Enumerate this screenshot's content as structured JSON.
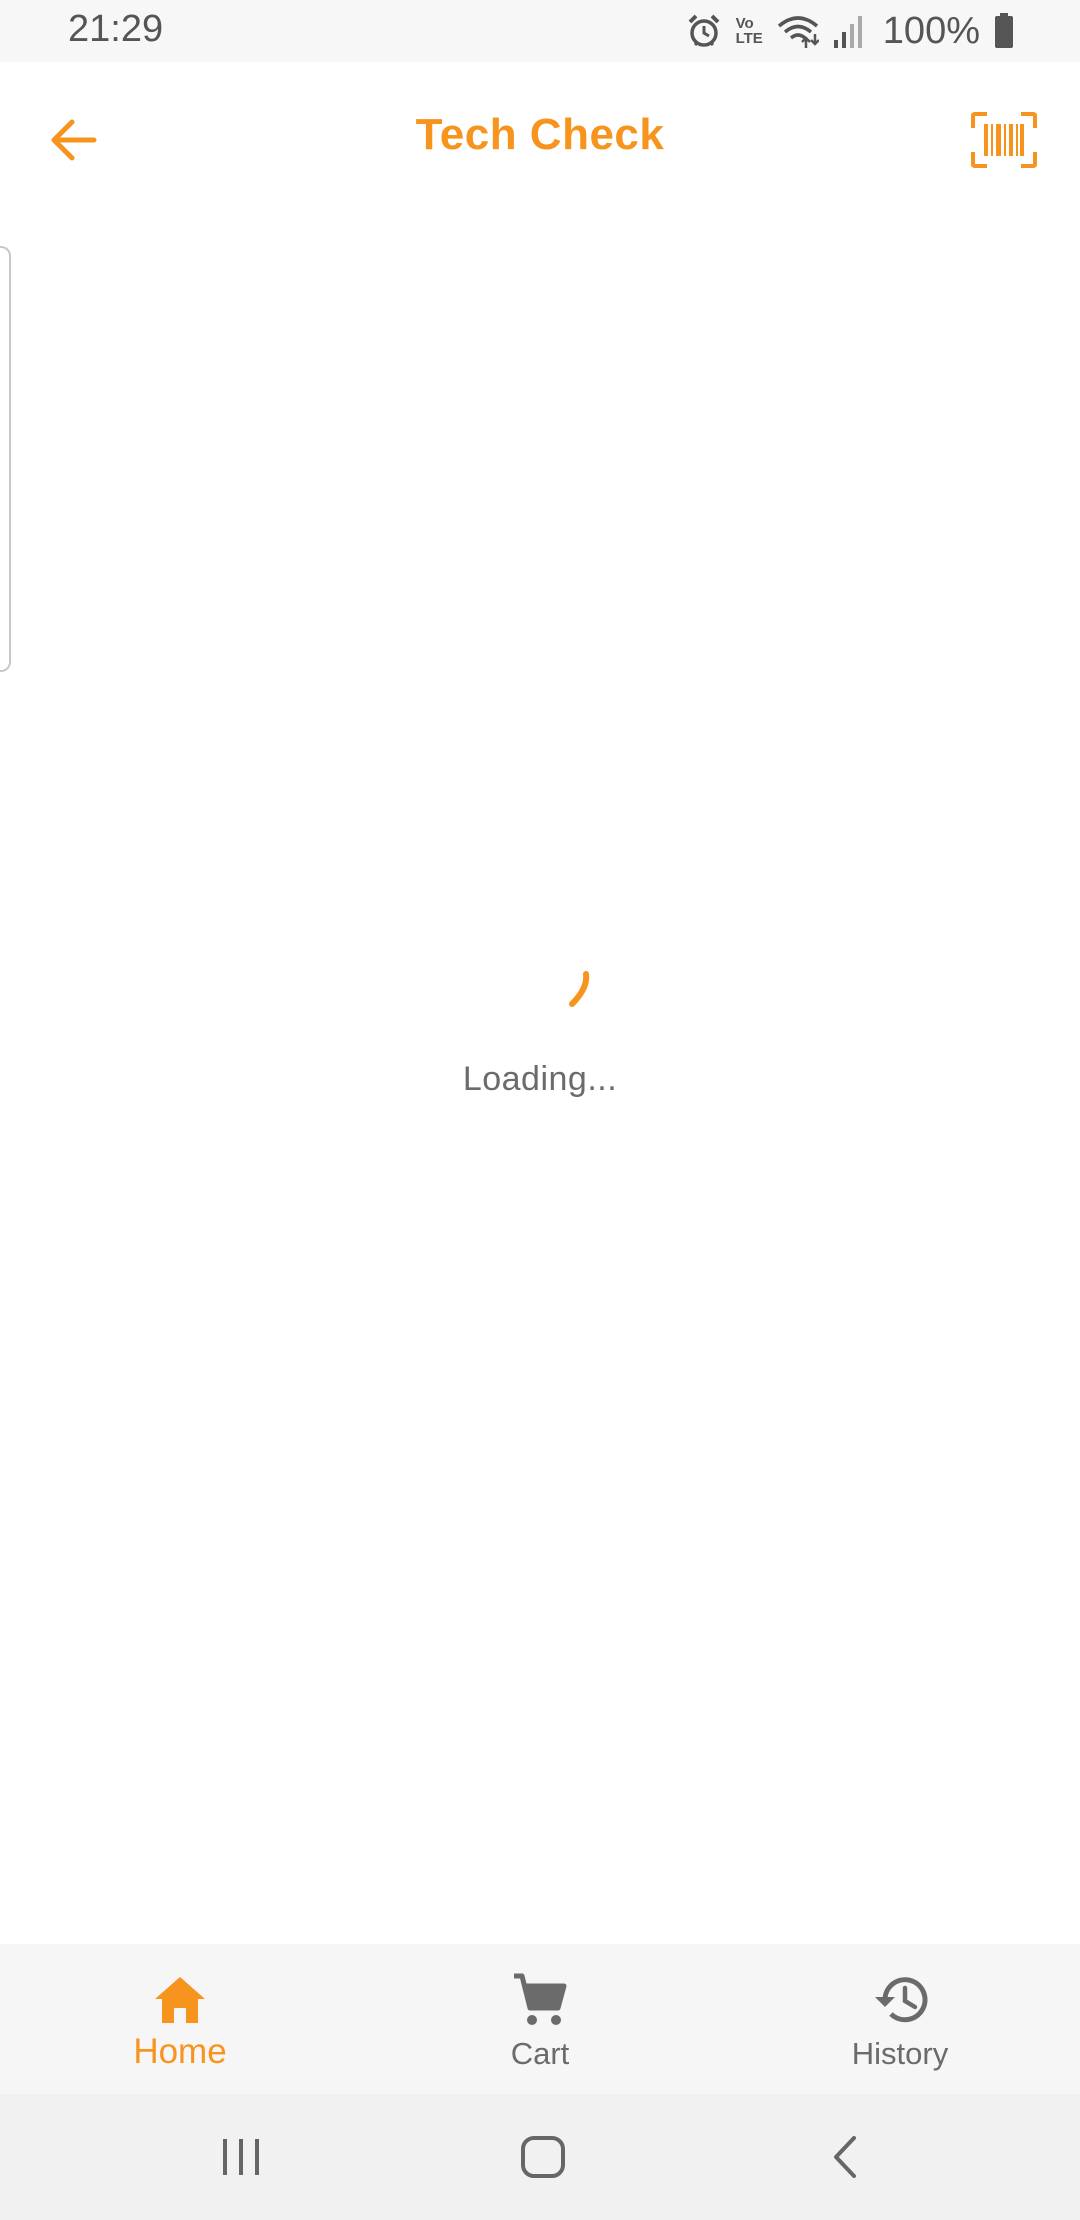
{
  "status_bar": {
    "time": "21:29",
    "battery": "100%",
    "icons": [
      "alarm-icon",
      "volte-icon",
      "wifi-icon",
      "signal-icon",
      "battery-icon"
    ],
    "volte_label_top": "Vo",
    "volte_label_bottom": "LTE"
  },
  "app_bar": {
    "title": "Tech Check",
    "back_icon": "arrow-left-icon",
    "scan_icon": "barcode-scan-icon"
  },
  "loading": {
    "text": "Loading..."
  },
  "bottom_nav": {
    "items": [
      {
        "label": "Home",
        "icon": "home-icon",
        "active": true
      },
      {
        "label": "Cart",
        "icon": "cart-icon",
        "active": false
      },
      {
        "label": "History",
        "icon": "history-icon",
        "active": false
      }
    ]
  },
  "system_nav": {
    "icons": [
      "recent-apps-icon",
      "home-circle-icon",
      "back-chevron-icon"
    ]
  },
  "colors": {
    "accent": "#f7941d",
    "text_secondary": "#6b6b6b",
    "status_text": "#555555",
    "nav_background": "#f6f6f6"
  }
}
